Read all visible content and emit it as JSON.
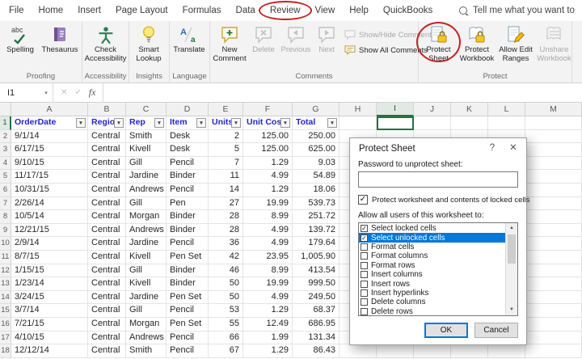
{
  "tabs": {
    "items": [
      {
        "label": "File"
      },
      {
        "label": "Home"
      },
      {
        "label": "Insert"
      },
      {
        "label": "Page Layout"
      },
      {
        "label": "Formulas"
      },
      {
        "label": "Data"
      },
      {
        "label": "Review",
        "annotated": true
      },
      {
        "label": "View"
      },
      {
        "label": "Help"
      },
      {
        "label": "QuickBooks"
      }
    ],
    "search_label": "Tell me what you want to"
  },
  "ribbon": {
    "spelling": "Spelling",
    "thesaurus": "Thesaurus",
    "check_accessibility": "Check Accessibility",
    "smart_lookup": "Smart Lookup",
    "translate": "Translate",
    "new_comment": "New Comment",
    "delete": "Delete",
    "previous": "Previous",
    "next": "Next",
    "show_hide_comment": "Show/Hide Comment",
    "show_all_comments": "Show All Comments",
    "protect_sheet": "Protect Sheet",
    "protect_workbook": "Protect Workbook",
    "allow_edit_ranges": "Allow Edit Ranges",
    "unshare_workbook": "Unshare Workbook",
    "groups": {
      "proofing": "Proofing",
      "accessibility": "Accessibility",
      "insights": "Insights",
      "language": "Language",
      "comments": "Comments",
      "protect": "Protect"
    }
  },
  "formula_bar": {
    "name_box": "I1",
    "fx": "fx"
  },
  "sheet": {
    "col_letters": [
      "A",
      "B",
      "C",
      "D",
      "E",
      "F",
      "G",
      "H",
      "I",
      "J",
      "K",
      "L",
      "M"
    ],
    "selected_col": "I",
    "active_cell": "I1",
    "filter_headers": [
      "OrderDate",
      "Region",
      "Rep",
      "Item",
      "Units",
      "Unit Cost",
      "Total"
    ],
    "rows": [
      [
        "9/1/14",
        "Central",
        "Smith",
        "Desk",
        "2",
        "125.00",
        "250.00"
      ],
      [
        "6/17/15",
        "Central",
        "Kivell",
        "Desk",
        "5",
        "125.00",
        "625.00"
      ],
      [
        "9/10/15",
        "Central",
        "Gill",
        "Pencil",
        "7",
        "1.29",
        "9.03"
      ],
      [
        "11/17/15",
        "Central",
        "Jardine",
        "Binder",
        "11",
        "4.99",
        "54.89"
      ],
      [
        "10/31/15",
        "Central",
        "Andrews",
        "Pencil",
        "14",
        "1.29",
        "18.06"
      ],
      [
        "2/26/14",
        "Central",
        "Gill",
        "Pen",
        "27",
        "19.99",
        "539.73"
      ],
      [
        "10/5/14",
        "Central",
        "Morgan",
        "Binder",
        "28",
        "8.99",
        "251.72"
      ],
      [
        "12/21/15",
        "Central",
        "Andrews",
        "Binder",
        "28",
        "4.99",
        "139.72"
      ],
      [
        "2/9/14",
        "Central",
        "Jardine",
        "Pencil",
        "36",
        "4.99",
        "179.64"
      ],
      [
        "8/7/15",
        "Central",
        "Kivell",
        "Pen Set",
        "42",
        "23.95",
        "1,005.90"
      ],
      [
        "1/15/15",
        "Central",
        "Gill",
        "Binder",
        "46",
        "8.99",
        "413.54"
      ],
      [
        "1/23/14",
        "Central",
        "Kivell",
        "Binder",
        "50",
        "19.99",
        "999.50"
      ],
      [
        "3/24/15",
        "Central",
        "Jardine",
        "Pen Set",
        "50",
        "4.99",
        "249.50"
      ],
      [
        "3/7/14",
        "Central",
        "Gill",
        "Pencil",
        "53",
        "1.29",
        "68.37"
      ],
      [
        "7/21/15",
        "Central",
        "Morgan",
        "Pen Set",
        "55",
        "12.49",
        "686.95"
      ],
      [
        "4/10/15",
        "Central",
        "Andrews",
        "Pencil",
        "66",
        "1.99",
        "131.34"
      ],
      [
        "12/12/14",
        "Central",
        "Smith",
        "Pencil",
        "67",
        "1.29",
        "86.43"
      ]
    ]
  },
  "dialog": {
    "title": "Protect Sheet",
    "help_icon": "?",
    "close_icon": "✕",
    "password_label": "Password to unprotect sheet:",
    "password_value": "",
    "protect_checkbox_label": "Protect worksheet and contents of locked cells",
    "protect_checkbox_checked": true,
    "allow_label": "Allow all users of this worksheet to:",
    "options": [
      {
        "label": "Select locked cells",
        "checked": true
      },
      {
        "label": "Select unlocked cells",
        "checked": true,
        "selected": true
      },
      {
        "label": "Format cells",
        "checked": false
      },
      {
        "label": "Format columns",
        "checked": false
      },
      {
        "label": "Format rows",
        "checked": false
      },
      {
        "label": "Insert columns",
        "checked": false
      },
      {
        "label": "Insert rows",
        "checked": false
      },
      {
        "label": "Insert hyperlinks",
        "checked": false
      },
      {
        "label": "Delete columns",
        "checked": false
      },
      {
        "label": "Delete rows",
        "checked": false
      }
    ],
    "ok_label": "OK",
    "cancel_label": "Cancel"
  },
  "colors": {
    "accent": "#217346",
    "selection": "#0078d7",
    "annotation": "#c42222",
    "header_text": "#2424cb"
  }
}
